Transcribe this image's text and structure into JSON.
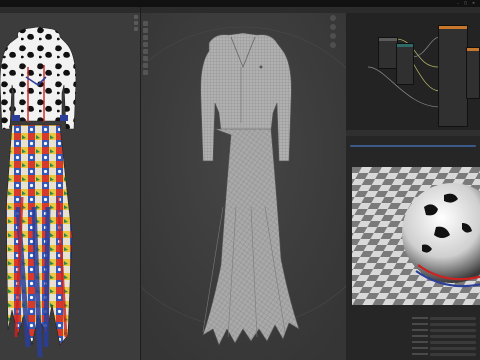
{
  "window": {
    "title": "",
    "controls": "– ▢ ✕"
  },
  "colors": {
    "viewport_bg": "#3d3d3d",
    "node_header_orange": "#c8782a",
    "node_header_teal": "#2e6b68",
    "node_header_gray": "#5a5a5a",
    "accent_blue": "#3b5a8a",
    "mesh_gray": "#a6a6a6"
  },
  "node_editor": {
    "menu": ""
  },
  "viewport_stats": [
    "",
    "",
    "",
    "",
    ""
  ],
  "icons": [
    "move-icon",
    "rotate-icon",
    "scale-icon",
    "zoom-icon",
    "hand-icon",
    "camera-icon"
  ]
}
